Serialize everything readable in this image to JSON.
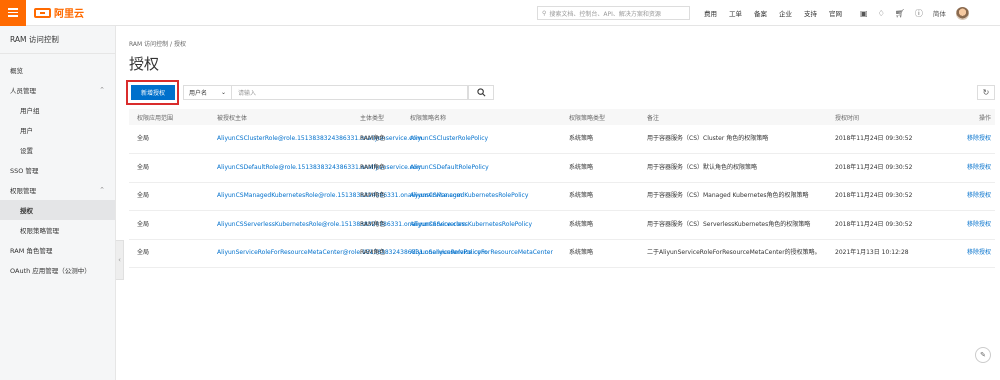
{
  "topbar": {
    "logo_text": "阿里云",
    "search_placeholder": "搜索文档、控制台、API、解决方案和资源",
    "links": [
      "费用",
      "工单",
      "备案",
      "企业",
      "支持",
      "官网"
    ],
    "lang": "简体"
  },
  "sidebar": {
    "title": "RAM 访问控制",
    "items": [
      {
        "label": "概览",
        "level": 0
      },
      {
        "label": "人员管理",
        "level": 0,
        "expanded": true
      },
      {
        "label": "用户组",
        "level": 1
      },
      {
        "label": "用户",
        "level": 1
      },
      {
        "label": "设置",
        "level": 1
      },
      {
        "label": "SSO 管理",
        "level": 0
      },
      {
        "label": "权限管理",
        "level": 0,
        "expanded": true
      },
      {
        "label": "授权",
        "level": 1,
        "active": true
      },
      {
        "label": "权限策略管理",
        "level": 1
      },
      {
        "label": "RAM 角色管理",
        "level": 0
      },
      {
        "label": "OAuth 应用管理（公测中）",
        "level": 0
      }
    ]
  },
  "main": {
    "breadcrumb": "RAM 访问控制  /  授权",
    "title": "授权",
    "add_button": "新增授权",
    "filter_select": "用户名",
    "filter_placeholder": "请输入"
  },
  "table": {
    "headers": [
      "权限应用范围",
      "被授权主体",
      "主体类型",
      "权限策略名称",
      "权限策略类型",
      "备注",
      "授权时间",
      "操作"
    ],
    "rows": [
      [
        "全局",
        "AliyunCSClusterRole@role.1513838324386331.onaliyunservice.com",
        "RAM角色",
        "AliyunCSClusterRolePolicy",
        "系统策略",
        "用于容器服务（CS）Cluster 角色的权限策略",
        "2018年11月24日 09:30:52",
        "移除授权"
      ],
      [
        "全局",
        "AliyunCSDefaultRole@role.1513838324386331.onaliyunservice.com",
        "RAM角色",
        "AliyunCSDefaultRolePolicy",
        "系统策略",
        "用于容器服务（CS）默认角色的权限策略",
        "2018年11月24日 09:30:52",
        "移除授权"
      ],
      [
        "全局",
        "AliyunCSManagedKubernetesRole@role.1513838324386331.onaliyunservice.com",
        "RAM角色",
        "AliyunCSManagedKubernetesRolePolicy",
        "系统策略",
        "用于容器服务（CS）Managed Kubernetes角色的权限策略",
        "2018年11月24日 09:30:52",
        "移除授权"
      ],
      [
        "全局",
        "AliyunCSServerlessKubernetesRole@role.1513838324386331.onaliyunservice.com",
        "RAM角色",
        "AliyunCSServerlessKubernetesRolePolicy",
        "系统策略",
        "用于容器服务（CS）ServerlessKubernetes角色的权限策略",
        "2018年11月24日 09:30:52",
        "移除授权"
      ],
      [
        "全局",
        "AliyunServiceRoleForResourceMetaCenter@role.1513838324386331.onaliyunservice.com",
        "RAM角色",
        "AliyunServiceRolePolicyForResourceMetaCenter",
        "系统策略",
        "二于AliyunServiceRoleForResourceMetaCenter的授权策略。",
        "2021年1月13日 10:12:28",
        "移除授权"
      ]
    ]
  },
  "colors": {
    "brand": "#ff6a00",
    "primary": "#0070cc",
    "highlight": "#d92c2c"
  }
}
